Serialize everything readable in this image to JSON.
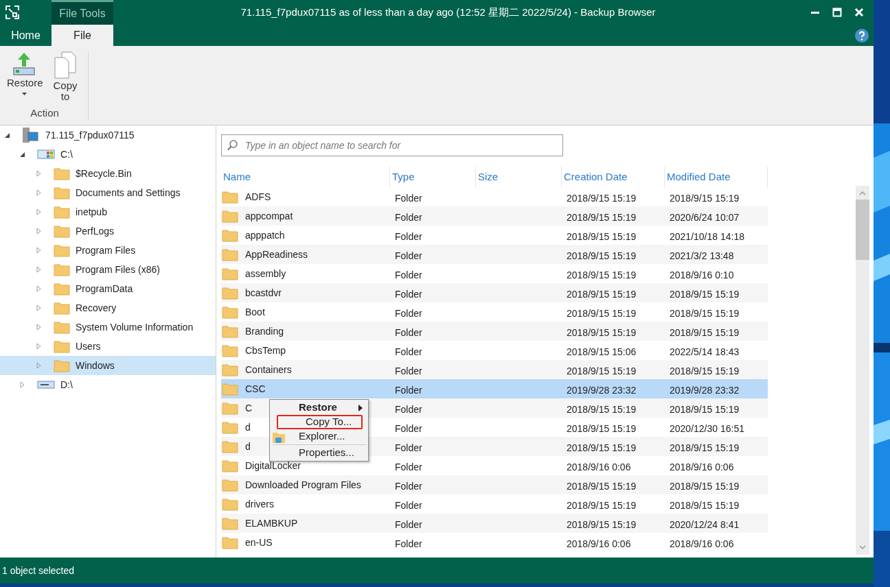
{
  "window": {
    "title": "71.115_f7pdux07115 as of less than a day ago (12:52 星期二 2022/5/24) - Backup Browser",
    "context_tab": "File Tools"
  },
  "tabs": [
    {
      "label": "Home",
      "selected": false
    },
    {
      "label": "File",
      "selected": true
    }
  ],
  "ribbon": {
    "buttons": [
      {
        "label": "Restore",
        "kind": "restore",
        "dropdown": true
      },
      {
        "label": "Copy to",
        "kind": "copy",
        "dropdown": false
      }
    ],
    "group_label": "Action"
  },
  "tree": {
    "items": [
      {
        "label": "71.115_f7pdux07115",
        "kind": "server",
        "expanded": true,
        "selected": false,
        "children": [
          {
            "label": "C:\\",
            "kind": "drive_c",
            "expanded": true,
            "selected": false,
            "children": [
              {
                "label": "$Recycle.Bin",
                "kind": "folder",
                "expanded": false,
                "selected": false
              },
              {
                "label": "Documents and Settings",
                "kind": "folder",
                "expanded": false,
                "selected": false
              },
              {
                "label": "inetpub",
                "kind": "folder",
                "expanded": false,
                "selected": false
              },
              {
                "label": "PerfLogs",
                "kind": "folder",
                "expanded": false,
                "selected": false
              },
              {
                "label": "Program Files",
                "kind": "folder",
                "expanded": false,
                "selected": false
              },
              {
                "label": "Program Files (x86)",
                "kind": "folder",
                "expanded": false,
                "selected": false
              },
              {
                "label": "ProgramData",
                "kind": "folder",
                "expanded": false,
                "selected": false
              },
              {
                "label": "Recovery",
                "kind": "folder",
                "expanded": false,
                "selected": false
              },
              {
                "label": "System Volume Information",
                "kind": "folder",
                "expanded": false,
                "selected": false
              },
              {
                "label": "Users",
                "kind": "folder",
                "expanded": false,
                "selected": false
              },
              {
                "label": "Windows",
                "kind": "folder",
                "expanded": false,
                "selected": true
              }
            ]
          },
          {
            "label": "D:\\",
            "kind": "drive",
            "expanded": false,
            "selected": false
          }
        ]
      }
    ]
  },
  "search": {
    "placeholder": "Type in an object name to search for"
  },
  "table": {
    "columns": [
      "Name",
      "Type",
      "Size",
      "Creation Date",
      "Modified Date"
    ],
    "rows": [
      {
        "name": "ADFS",
        "type": "Folder",
        "created": "2018/9/15 15:19",
        "modified": "2018/9/15 15:19",
        "selected": false
      },
      {
        "name": "appcompat",
        "type": "Folder",
        "created": "2018/9/15 15:19",
        "modified": "2020/6/24 10:07",
        "selected": false
      },
      {
        "name": "apppatch",
        "type": "Folder",
        "created": "2018/9/15 15:19",
        "modified": "2021/10/18 14:18",
        "selected": false
      },
      {
        "name": "AppReadiness",
        "type": "Folder",
        "created": "2018/9/15 15:19",
        "modified": "2021/3/2 13:48",
        "selected": false
      },
      {
        "name": "assembly",
        "type": "Folder",
        "created": "2018/9/15 15:19",
        "modified": "2018/9/16 0:10",
        "selected": false
      },
      {
        "name": "bcastdvr",
        "type": "Folder",
        "created": "2018/9/15 15:19",
        "modified": "2018/9/15 15:19",
        "selected": false
      },
      {
        "name": "Boot",
        "type": "Folder",
        "created": "2018/9/15 15:19",
        "modified": "2018/9/15 15:19",
        "selected": false
      },
      {
        "name": "Branding",
        "type": "Folder",
        "created": "2018/9/15 15:19",
        "modified": "2018/9/15 15:19",
        "selected": false
      },
      {
        "name": "CbsTemp",
        "type": "Folder",
        "created": "2018/9/15 15:06",
        "modified": "2022/5/14 18:43",
        "selected": false
      },
      {
        "name": "Containers",
        "type": "Folder",
        "created": "2018/9/15 15:19",
        "modified": "2018/9/15 15:19",
        "selected": false
      },
      {
        "name": "CSC",
        "type": "Folder",
        "created": "2019/9/28 23:32",
        "modified": "2019/9/28 23:32",
        "selected": true
      },
      {
        "name": "C",
        "type": "Folder",
        "created": "2018/9/15 15:19",
        "modified": "2018/9/15 15:19",
        "selected": false
      },
      {
        "name": "d",
        "type": "Folder",
        "created": "2018/9/15 15:19",
        "modified": "2020/12/30 16:51",
        "selected": false
      },
      {
        "name": "d",
        "type": "Folder",
        "created": "2018/9/15 15:19",
        "modified": "2018/9/15 15:19",
        "selected": false
      },
      {
        "name": "DigitalLocker",
        "type": "Folder",
        "created": "2018/9/16 0:06",
        "modified": "2018/9/16 0:06",
        "selected": false
      },
      {
        "name": "Downloaded Program Files",
        "type": "Folder",
        "created": "2018/9/15 15:19",
        "modified": "2018/9/15 15:19",
        "selected": false
      },
      {
        "name": "drivers",
        "type": "Folder",
        "created": "2018/9/15 15:19",
        "modified": "2018/9/15 15:19",
        "selected": false
      },
      {
        "name": "ELAMBKUP",
        "type": "Folder",
        "created": "2018/9/15 15:19",
        "modified": "2020/12/24 8:41",
        "selected": false
      },
      {
        "name": "en-US",
        "type": "Folder",
        "created": "2018/9/16 0:06",
        "modified": "2018/9/16 0:06",
        "selected": false
      }
    ]
  },
  "context_menu": {
    "items": [
      {
        "label": "Restore",
        "kind": "submenu",
        "bold": true,
        "highlighted": false
      },
      {
        "label": "Copy To...",
        "kind": "item",
        "bold": false,
        "highlighted": true
      },
      {
        "label": "Explorer...",
        "kind": "explorer",
        "bold": false,
        "highlighted": false
      },
      {
        "label": "Properties...",
        "kind": "separated",
        "bold": false,
        "highlighted": false
      }
    ]
  },
  "status_bar": {
    "text": "1 object selected"
  }
}
